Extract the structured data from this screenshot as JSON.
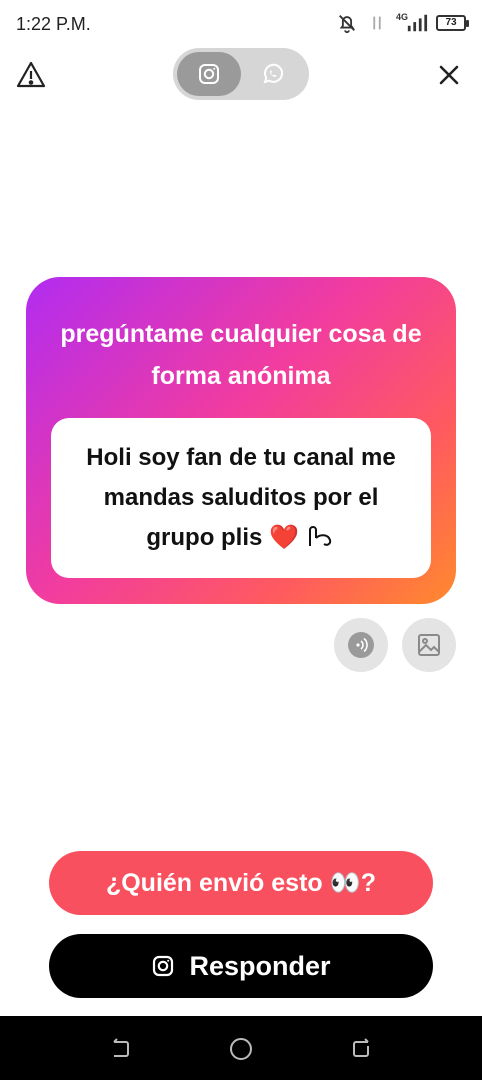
{
  "status_bar": {
    "time": "1:22 P.M.",
    "network_label": "4G",
    "battery": "73"
  },
  "header": {
    "toggle_options": [
      {
        "icon": "instagram-icon",
        "selected": true
      },
      {
        "icon": "whatsapp-icon",
        "selected": false
      }
    ]
  },
  "card": {
    "title": "pregúntame cualquier cosa de forma anónima",
    "message": "Holi soy fan de tu canal me mandas saluditos por el grupo plis",
    "message_emoji": "❤️",
    "gradient_colors": [
      "#b12cf1",
      "#f23c9f",
      "#ff5a5f",
      "#ff8a2c"
    ]
  },
  "actions": {
    "who_sent_label": "¿Quién envió esto 👀?",
    "reply_label": "Responder"
  },
  "colors": {
    "who_button": "#f9505f",
    "reply_button": "#000000"
  }
}
